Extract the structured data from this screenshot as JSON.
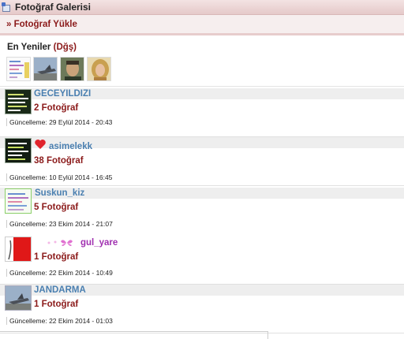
{
  "window": {
    "title": "Fotoğraf Galerisi",
    "icon": "gallery-icon"
  },
  "upload": {
    "label": "» Fotoğraf Yükle"
  },
  "latest": {
    "heading": "En Yeniler",
    "heading_link": "(Dğş)",
    "thumbnails": [
      {
        "name": "thumb-text-collage"
      },
      {
        "name": "thumb-jet"
      },
      {
        "name": "thumb-portrait-man"
      },
      {
        "name": "thumb-portrait-woman"
      }
    ]
  },
  "users": [
    {
      "name": "GECEYILDIZI",
      "count": "2 Fotoğraf",
      "updated": "Güncelleme: 29 Eylül 2014 - 20:43"
    },
    {
      "name": "asimelekk",
      "count": "38 Fotoğraf",
      "updated": "Güncelleme: 10 Eylül 2014 - 16:45"
    },
    {
      "name": "Suskun_kiz",
      "count": "5 Fotoğraf",
      "updated": "Güncelleme: 23 Ekim 2014 - 21:07"
    },
    {
      "name": "gul_yare",
      "count": "1 Fotoğraf",
      "updated": "Güncelleme: 22 Ekim 2014 - 10:49"
    },
    {
      "name": "JANDARMA",
      "count": "1 Fotoğraf",
      "updated": "Güncelleme: 22 Ekim 2014 - 01:03"
    }
  ],
  "colors": {
    "accent": "#8b1a1a",
    "link": "#4a7fb0",
    "title_bar": "#e5c9c9"
  }
}
